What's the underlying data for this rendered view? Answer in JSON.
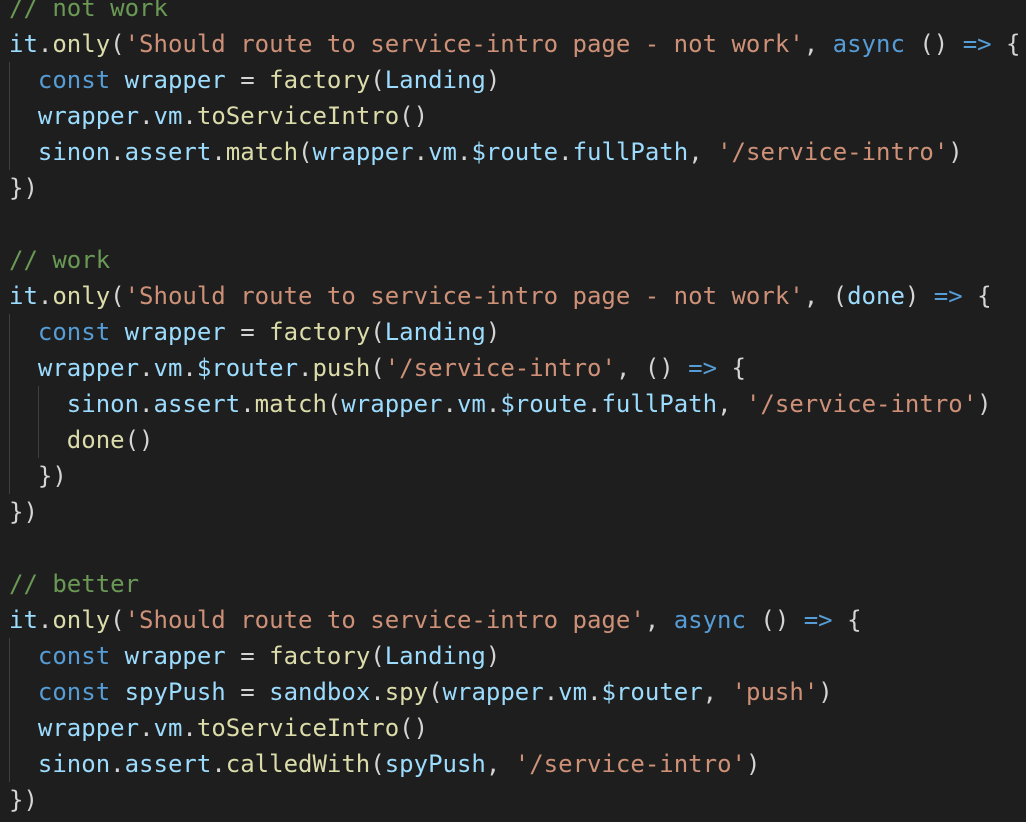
{
  "theme": {
    "background": "#1e1e1e",
    "default": "#d4d4d4",
    "comment": "#6a9955",
    "function": "#dcdcaa",
    "variable": "#9cdcfe",
    "string": "#ce9178",
    "keyword": "#569cd6",
    "indent_guide": "#404040"
  },
  "code": {
    "lines": [
      {
        "indent": 0,
        "tokens": [
          {
            "t": "// not work",
            "c": "comment"
          }
        ]
      },
      {
        "indent": 0,
        "tokens": [
          {
            "t": "it",
            "c": "var"
          },
          {
            "t": ".",
            "c": "op"
          },
          {
            "t": "only",
            "c": "fn"
          },
          {
            "t": "(",
            "c": "op"
          },
          {
            "t": "'Should route to service-intro page - not work'",
            "c": "str"
          },
          {
            "t": ", ",
            "c": "op"
          },
          {
            "t": "async",
            "c": "kw"
          },
          {
            "t": " () ",
            "c": "op"
          },
          {
            "t": "=>",
            "c": "kw"
          },
          {
            "t": " {",
            "c": "op"
          }
        ]
      },
      {
        "indent": 1,
        "tokens": [
          {
            "t": "const",
            "c": "kw"
          },
          {
            "t": " ",
            "c": "op"
          },
          {
            "t": "wrapper",
            "c": "var"
          },
          {
            "t": " = ",
            "c": "op"
          },
          {
            "t": "factory",
            "c": "fn"
          },
          {
            "t": "(",
            "c": "op"
          },
          {
            "t": "Landing",
            "c": "var"
          },
          {
            "t": ")",
            "c": "op"
          }
        ]
      },
      {
        "indent": 1,
        "tokens": [
          {
            "t": "wrapper",
            "c": "var"
          },
          {
            "t": ".",
            "c": "op"
          },
          {
            "t": "vm",
            "c": "var"
          },
          {
            "t": ".",
            "c": "op"
          },
          {
            "t": "toServiceIntro",
            "c": "fn"
          },
          {
            "t": "()",
            "c": "op"
          }
        ]
      },
      {
        "indent": 1,
        "tokens": [
          {
            "t": "sinon",
            "c": "var"
          },
          {
            "t": ".",
            "c": "op"
          },
          {
            "t": "assert",
            "c": "var"
          },
          {
            "t": ".",
            "c": "op"
          },
          {
            "t": "match",
            "c": "fn"
          },
          {
            "t": "(",
            "c": "op"
          },
          {
            "t": "wrapper",
            "c": "var"
          },
          {
            "t": ".",
            "c": "op"
          },
          {
            "t": "vm",
            "c": "var"
          },
          {
            "t": ".",
            "c": "op"
          },
          {
            "t": "$route",
            "c": "var"
          },
          {
            "t": ".",
            "c": "op"
          },
          {
            "t": "fullPath",
            "c": "var"
          },
          {
            "t": ", ",
            "c": "op"
          },
          {
            "t": "'/service-intro'",
            "c": "str"
          },
          {
            "t": ")",
            "c": "op"
          }
        ]
      },
      {
        "indent": 0,
        "tokens": [
          {
            "t": "})",
            "c": "op"
          }
        ]
      },
      {
        "indent": 0,
        "tokens": []
      },
      {
        "indent": 0,
        "tokens": [
          {
            "t": "// work",
            "c": "comment"
          }
        ]
      },
      {
        "indent": 0,
        "tokens": [
          {
            "t": "it",
            "c": "var"
          },
          {
            "t": ".",
            "c": "op"
          },
          {
            "t": "only",
            "c": "fn"
          },
          {
            "t": "(",
            "c": "op"
          },
          {
            "t": "'Should route to service-intro page - not work'",
            "c": "str"
          },
          {
            "t": ", (",
            "c": "op"
          },
          {
            "t": "done",
            "c": "var"
          },
          {
            "t": ") ",
            "c": "op"
          },
          {
            "t": "=>",
            "c": "kw"
          },
          {
            "t": " {",
            "c": "op"
          }
        ]
      },
      {
        "indent": 1,
        "tokens": [
          {
            "t": "const",
            "c": "kw"
          },
          {
            "t": " ",
            "c": "op"
          },
          {
            "t": "wrapper",
            "c": "var"
          },
          {
            "t": " = ",
            "c": "op"
          },
          {
            "t": "factory",
            "c": "fn"
          },
          {
            "t": "(",
            "c": "op"
          },
          {
            "t": "Landing",
            "c": "var"
          },
          {
            "t": ")",
            "c": "op"
          }
        ]
      },
      {
        "indent": 1,
        "tokens": [
          {
            "t": "wrapper",
            "c": "var"
          },
          {
            "t": ".",
            "c": "op"
          },
          {
            "t": "vm",
            "c": "var"
          },
          {
            "t": ".",
            "c": "op"
          },
          {
            "t": "$router",
            "c": "var"
          },
          {
            "t": ".",
            "c": "op"
          },
          {
            "t": "push",
            "c": "fn"
          },
          {
            "t": "(",
            "c": "op"
          },
          {
            "t": "'/service-intro'",
            "c": "str"
          },
          {
            "t": ", () ",
            "c": "op"
          },
          {
            "t": "=>",
            "c": "kw"
          },
          {
            "t": " {",
            "c": "op"
          }
        ]
      },
      {
        "indent": 2,
        "tokens": [
          {
            "t": "sinon",
            "c": "var"
          },
          {
            "t": ".",
            "c": "op"
          },
          {
            "t": "assert",
            "c": "var"
          },
          {
            "t": ".",
            "c": "op"
          },
          {
            "t": "match",
            "c": "fn"
          },
          {
            "t": "(",
            "c": "op"
          },
          {
            "t": "wrapper",
            "c": "var"
          },
          {
            "t": ".",
            "c": "op"
          },
          {
            "t": "vm",
            "c": "var"
          },
          {
            "t": ".",
            "c": "op"
          },
          {
            "t": "$route",
            "c": "var"
          },
          {
            "t": ".",
            "c": "op"
          },
          {
            "t": "fullPath",
            "c": "var"
          },
          {
            "t": ", ",
            "c": "op"
          },
          {
            "t": "'/service-intro'",
            "c": "str"
          },
          {
            "t": ")",
            "c": "op"
          }
        ]
      },
      {
        "indent": 2,
        "tokens": [
          {
            "t": "done",
            "c": "fn"
          },
          {
            "t": "()",
            "c": "op"
          }
        ]
      },
      {
        "indent": 1,
        "tokens": [
          {
            "t": "})",
            "c": "op"
          }
        ]
      },
      {
        "indent": 0,
        "tokens": [
          {
            "t": "})",
            "c": "op"
          }
        ]
      },
      {
        "indent": 0,
        "tokens": []
      },
      {
        "indent": 0,
        "tokens": [
          {
            "t": "// better",
            "c": "comment"
          }
        ]
      },
      {
        "indent": 0,
        "tokens": [
          {
            "t": "it",
            "c": "var"
          },
          {
            "t": ".",
            "c": "op"
          },
          {
            "t": "only",
            "c": "fn"
          },
          {
            "t": "(",
            "c": "op"
          },
          {
            "t": "'Should route to service-intro page'",
            "c": "str"
          },
          {
            "t": ", ",
            "c": "op"
          },
          {
            "t": "async",
            "c": "kw"
          },
          {
            "t": " () ",
            "c": "op"
          },
          {
            "t": "=>",
            "c": "kw"
          },
          {
            "t": " {",
            "c": "op"
          }
        ]
      },
      {
        "indent": 1,
        "tokens": [
          {
            "t": "const",
            "c": "kw"
          },
          {
            "t": " ",
            "c": "op"
          },
          {
            "t": "wrapper",
            "c": "var"
          },
          {
            "t": " = ",
            "c": "op"
          },
          {
            "t": "factory",
            "c": "fn"
          },
          {
            "t": "(",
            "c": "op"
          },
          {
            "t": "Landing",
            "c": "var"
          },
          {
            "t": ")",
            "c": "op"
          }
        ]
      },
      {
        "indent": 1,
        "tokens": [
          {
            "t": "const",
            "c": "kw"
          },
          {
            "t": " ",
            "c": "op"
          },
          {
            "t": "spyPush",
            "c": "var"
          },
          {
            "t": " = ",
            "c": "op"
          },
          {
            "t": "sandbox",
            "c": "var"
          },
          {
            "t": ".",
            "c": "op"
          },
          {
            "t": "spy",
            "c": "fn"
          },
          {
            "t": "(",
            "c": "op"
          },
          {
            "t": "wrapper",
            "c": "var"
          },
          {
            "t": ".",
            "c": "op"
          },
          {
            "t": "vm",
            "c": "var"
          },
          {
            "t": ".",
            "c": "op"
          },
          {
            "t": "$router",
            "c": "var"
          },
          {
            "t": ", ",
            "c": "op"
          },
          {
            "t": "'push'",
            "c": "str"
          },
          {
            "t": ")",
            "c": "op"
          }
        ]
      },
      {
        "indent": 1,
        "tokens": [
          {
            "t": "wrapper",
            "c": "var"
          },
          {
            "t": ".",
            "c": "op"
          },
          {
            "t": "vm",
            "c": "var"
          },
          {
            "t": ".",
            "c": "op"
          },
          {
            "t": "toServiceIntro",
            "c": "fn"
          },
          {
            "t": "()",
            "c": "op"
          }
        ]
      },
      {
        "indent": 1,
        "tokens": [
          {
            "t": "sinon",
            "c": "var"
          },
          {
            "t": ".",
            "c": "op"
          },
          {
            "t": "assert",
            "c": "var"
          },
          {
            "t": ".",
            "c": "op"
          },
          {
            "t": "calledWith",
            "c": "fn"
          },
          {
            "t": "(",
            "c": "op"
          },
          {
            "t": "spyPush",
            "c": "var"
          },
          {
            "t": ", ",
            "c": "op"
          },
          {
            "t": "'/service-intro'",
            "c": "str"
          },
          {
            "t": ")",
            "c": "op"
          }
        ]
      },
      {
        "indent": 0,
        "tokens": [
          {
            "t": "})",
            "c": "op"
          }
        ]
      }
    ]
  }
}
